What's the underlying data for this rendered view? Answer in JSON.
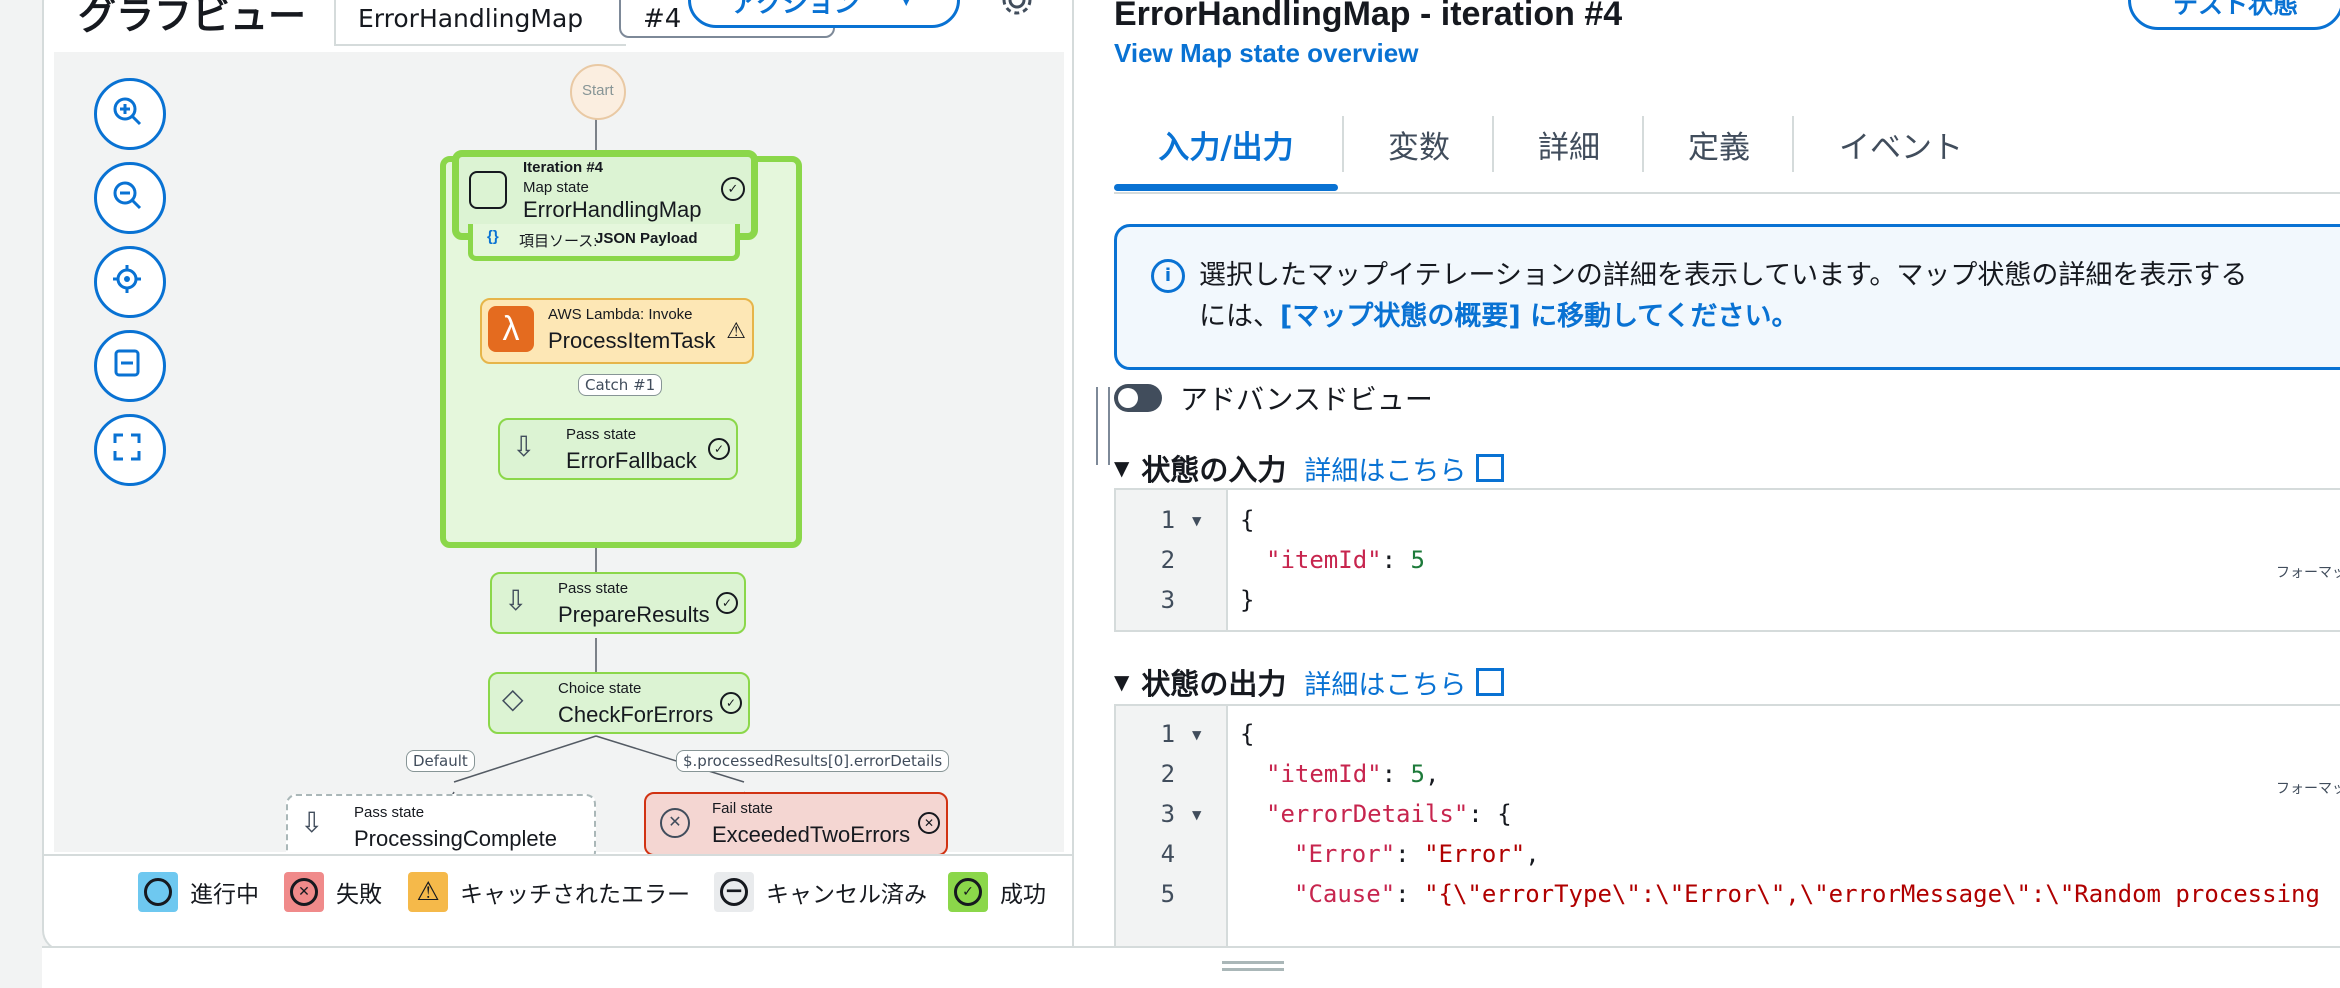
{
  "graph": {
    "title": "グラフビュー",
    "map_select": "ErrorHandlingMap",
    "iteration_select": "#4",
    "action_button": "アクション",
    "zoom_controls": [
      "zoom-in-icon",
      "zoom-out-icon",
      "center-icon",
      "fit-icon",
      "fullscreen-icon"
    ],
    "nodes": {
      "start": "Start",
      "map_iteration": "Iteration #4",
      "map_type": "Map state",
      "map_name": "ErrorHandlingMap",
      "item_source_label": "項目ソース:",
      "item_source_value": "JSON Payload",
      "lambda_type": "AWS Lambda: Invoke",
      "lambda_name": "ProcessItemTask",
      "catch_label": "Catch #1",
      "fallback_type": "Pass state",
      "fallback_name": "ErrorFallback",
      "prepare_type": "Pass state",
      "prepare_name": "PrepareResults",
      "choice_type": "Choice state",
      "choice_name": "CheckForErrors",
      "default_label": "Default",
      "rule_label": "$.processedResults[0].errorDetails",
      "complete_type": "Pass state",
      "complete_name": "ProcessingComplete",
      "fail_type": "Fail state",
      "fail_name": "ExceededTwoErrors"
    },
    "legend": {
      "in_progress": "進行中",
      "failed": "失敗",
      "caught_error": "キャッチされたエラー",
      "cancelled": "キャンセル済み",
      "succeeded": "成功"
    }
  },
  "detail": {
    "title": "ErrorHandlingMap - iteration #4",
    "test_button": "テスト状態",
    "overview_link": "View Map state overview",
    "tabs": [
      "入力/出力",
      "変数",
      "詳細",
      "定義",
      "イベント"
    ],
    "alert_text": "選択したマップイテレーションの詳細を表示しています。マップ状態の詳細を表示するには、",
    "alert_link": "[マップ状態の概要] に移動してください。",
    "advanced_view": "アドバンスドビュー",
    "input_section": "状態の入力",
    "output_section": "状態の出力",
    "learn_more": "詳細はこちら",
    "formatted_label": "フォーマット済み",
    "input_lines": [
      {
        "n": "1",
        "fold": "▾",
        "text": "{"
      },
      {
        "n": "2",
        "fold": "",
        "key": "\"itemId\"",
        "rest": ": ",
        "num": "5"
      },
      {
        "n": "3",
        "fold": "",
        "text": "}"
      }
    ],
    "output_lines": [
      {
        "n": "1",
        "fold": "▾",
        "text": "{"
      },
      {
        "n": "2",
        "fold": "",
        "key": "\"itemId\"",
        "rest": ": ",
        "num": "5",
        "tail": ","
      },
      {
        "n": "3",
        "fold": "▾",
        "key": "\"errorDetails\"",
        "rest": ": {"
      },
      {
        "n": "4",
        "fold": "",
        "key": "\"Error\"",
        "rest": ": ",
        "str": "\"Error\"",
        "tail": ","
      },
      {
        "n": "5",
        "fold": "",
        "key": "\"Cause\"",
        "rest": ": ",
        "str": "\"{\\\"errorType\\\":\\\"Error\\\",\\\"errorMessage\\\":\\\"Random processing"
      }
    ]
  }
}
